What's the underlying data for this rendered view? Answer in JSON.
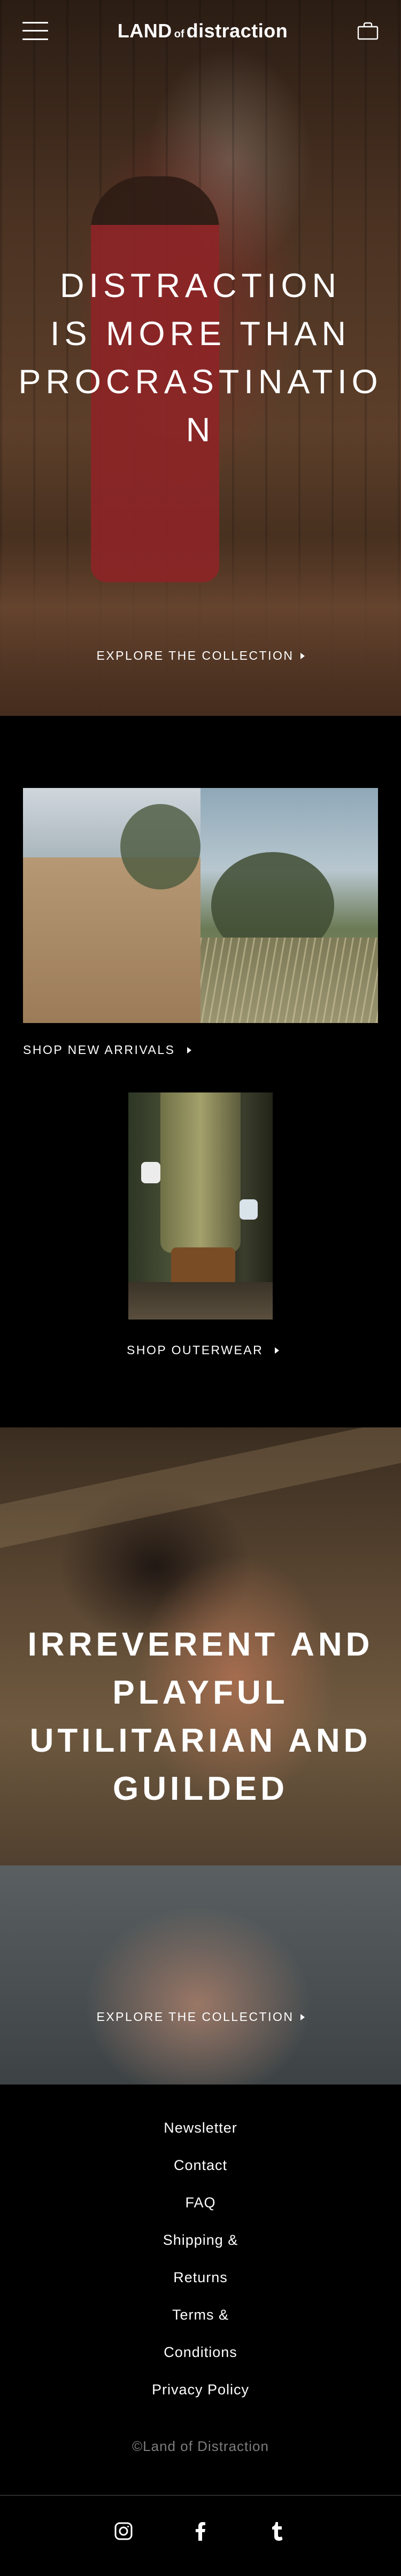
{
  "header": {
    "logo_land": "LAND",
    "logo_of": "of",
    "logo_distraction": "distraction"
  },
  "hero": {
    "title_lines": [
      "DISTRACTION",
      "IS MORE THAN",
      "PROCRASTINATIO",
      "N"
    ],
    "cta": "EXPLORE THE COLLECTION"
  },
  "sections": {
    "new_arrivals": "SHOP NEW ARRIVALS",
    "outerwear": "SHOP OUTERWEAR"
  },
  "hero2": {
    "title_lines": [
      "IRREVERENT AND",
      "PLAYFUL",
      "UTILITARIAN AND",
      "GUILDED"
    ],
    "cta": "EXPLORE THE COLLECTION"
  },
  "footer": {
    "links": [
      "Newsletter",
      "Contact",
      "FAQ",
      "Shipping &",
      "Returns",
      "Terms &",
      "Conditions",
      "Privacy Policy"
    ],
    "copyright": "©Land of Distraction"
  },
  "icons": {
    "menu": "hamburger-menu-icon",
    "bag": "shopping-bag-icon",
    "instagram": "instagram-icon",
    "facebook": "facebook-icon",
    "tumblr": "tumblr-icon"
  },
  "colors": {
    "background": "#000000",
    "text": "#ffffff",
    "muted": "#7c7c7c"
  }
}
